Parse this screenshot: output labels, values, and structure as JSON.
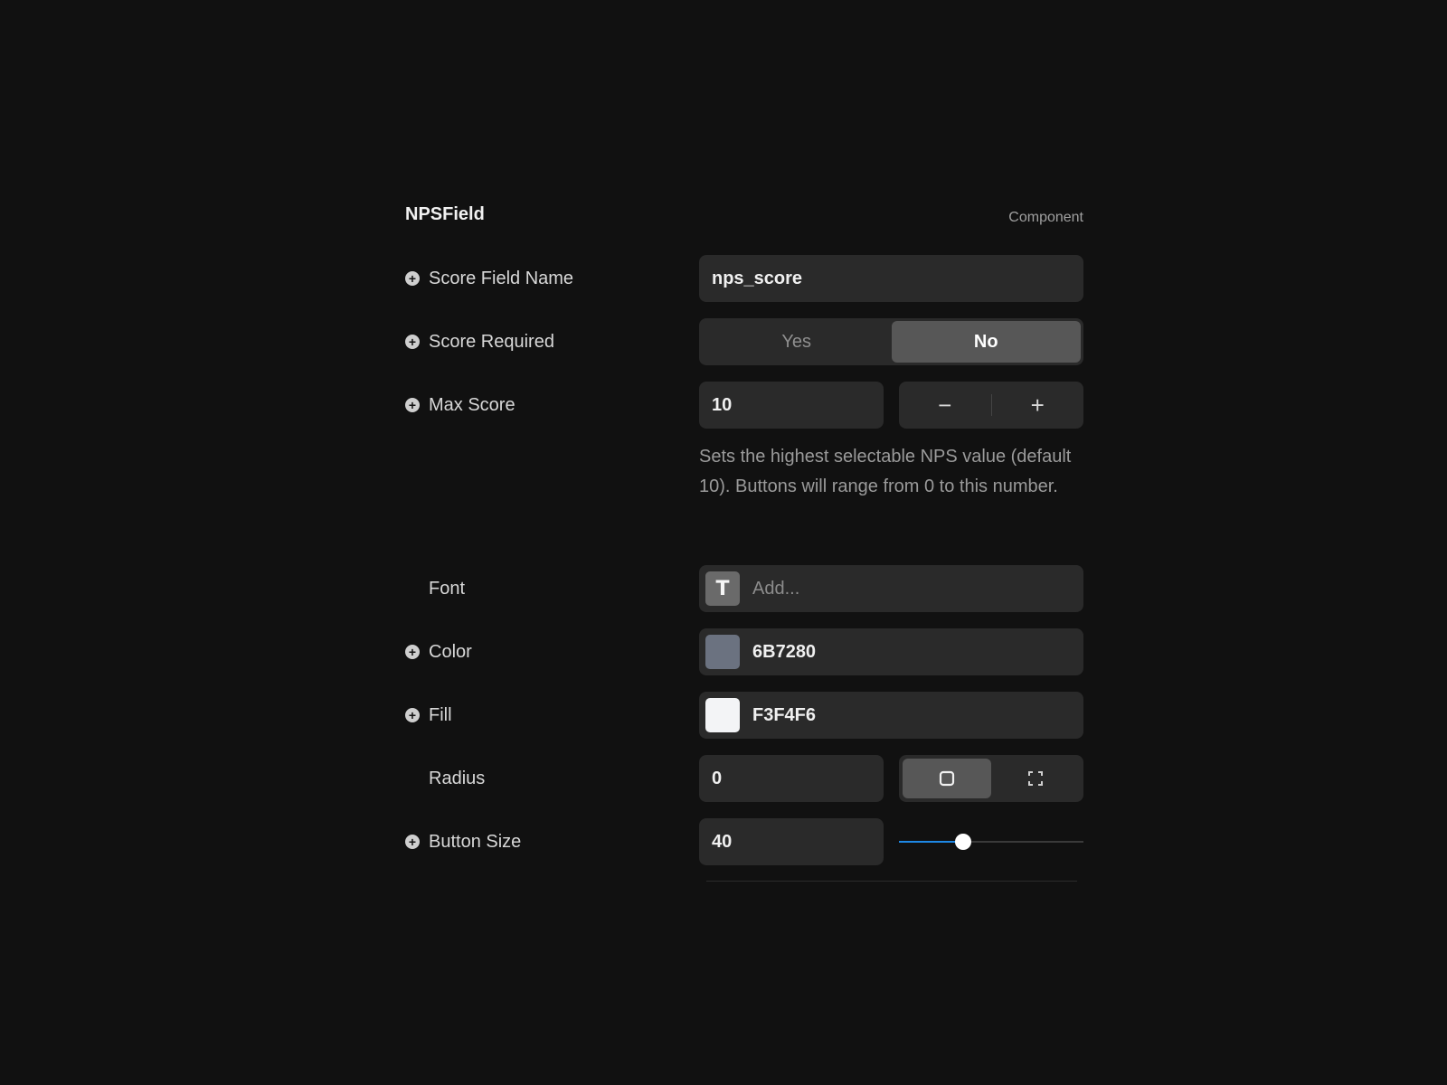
{
  "panel": {
    "title": "NPSField",
    "kind": "Component"
  },
  "fields": {
    "score_field_name": {
      "label": "Score Field Name",
      "value": "nps_score"
    },
    "score_required": {
      "label": "Score Required",
      "options": [
        "Yes",
        "No"
      ],
      "selected": "No"
    },
    "max_score": {
      "label": "Max Score",
      "value": "10",
      "decrement": "−",
      "increment": "+",
      "helper": "Sets the highest selectable NPS value (default 10). Buttons will range from 0 to this number."
    },
    "font": {
      "label": "Font",
      "icon_glyph": "T",
      "placeholder": "Add..."
    },
    "color": {
      "label": "Color",
      "value": "6B7280",
      "swatch": "#6B7280"
    },
    "fill": {
      "label": "Fill",
      "value": "F3F4F6",
      "swatch": "#F3F4F6"
    },
    "radius": {
      "label": "Radius",
      "value": "0",
      "modes": [
        "uniform",
        "per-corner"
      ],
      "selected_mode": "uniform"
    },
    "button_size": {
      "label": "Button Size",
      "value": "40",
      "slider_fraction": 0.35
    }
  },
  "colors": {
    "background": "#111111",
    "surface": "#2a2a2a",
    "accent": "#1e88e5"
  }
}
